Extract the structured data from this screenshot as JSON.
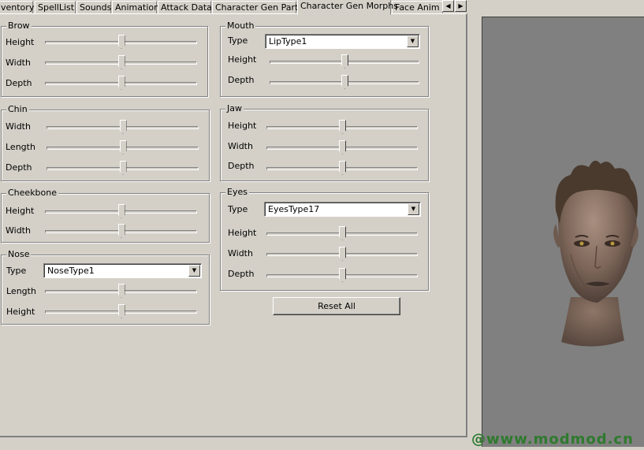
{
  "tabs": [
    {
      "label": "ventory"
    },
    {
      "label": "SpellList"
    },
    {
      "label": "Sounds"
    },
    {
      "label": "Animation"
    },
    {
      "label": "Attack Data"
    },
    {
      "label": "Character Gen Parts"
    },
    {
      "label": "Character Gen Morphs",
      "active": true
    },
    {
      "label": "Face Anim F"
    }
  ],
  "groups": {
    "brow": {
      "title": "Brow",
      "height_label": "Height",
      "width_label": "Width",
      "depth_label": "Depth",
      "height_value": 0.5,
      "width_value": 0.5,
      "depth_value": 0.5
    },
    "chin": {
      "title": "Chin",
      "width_label": "Width",
      "length_label": "Length",
      "depth_label": "Depth",
      "width_value": 0.5,
      "length_value": 0.5,
      "depth_value": 0.5
    },
    "cheekbone": {
      "title": "Cheekbone",
      "height_label": "Height",
      "width_label": "Width",
      "height_value": 0.5,
      "width_value": 0.5
    },
    "nose": {
      "title": "Nose",
      "type_label": "Type",
      "type_value": "NoseType1",
      "length_label": "Length",
      "height_label": "Height",
      "length_value": 0.5,
      "height_value": 0.5
    },
    "mouth": {
      "title": "Mouth",
      "type_label": "Type",
      "type_value": "LipType1",
      "height_label": "Height",
      "depth_label": "Depth",
      "height_value": 0.5,
      "depth_value": 0.5
    },
    "jaw": {
      "title": "Jaw",
      "height_label": "Height",
      "width_label": "Width",
      "depth_label": "Depth",
      "height_value": 0.5,
      "width_value": 0.5,
      "depth_value": 0.5
    },
    "eyes": {
      "title": "Eyes",
      "type_label": "Type",
      "type_value": "EyesType17",
      "height_label": "Height",
      "width_label": "Width",
      "depth_label": "Depth",
      "height_value": 0.5,
      "width_value": 0.5,
      "depth_value": 0.5
    }
  },
  "reset_button": "Reset All",
  "watermark": "@www.modmod.cn",
  "icons": {
    "tab_scroll_left": "triangle-left-icon",
    "tab_scroll_right": "triangle-right-icon",
    "dropdown": "triangle-down-icon"
  },
  "colors": {
    "face": "#d4d0c8",
    "viewport": "#808080",
    "watermark": "#2e7a2e"
  }
}
